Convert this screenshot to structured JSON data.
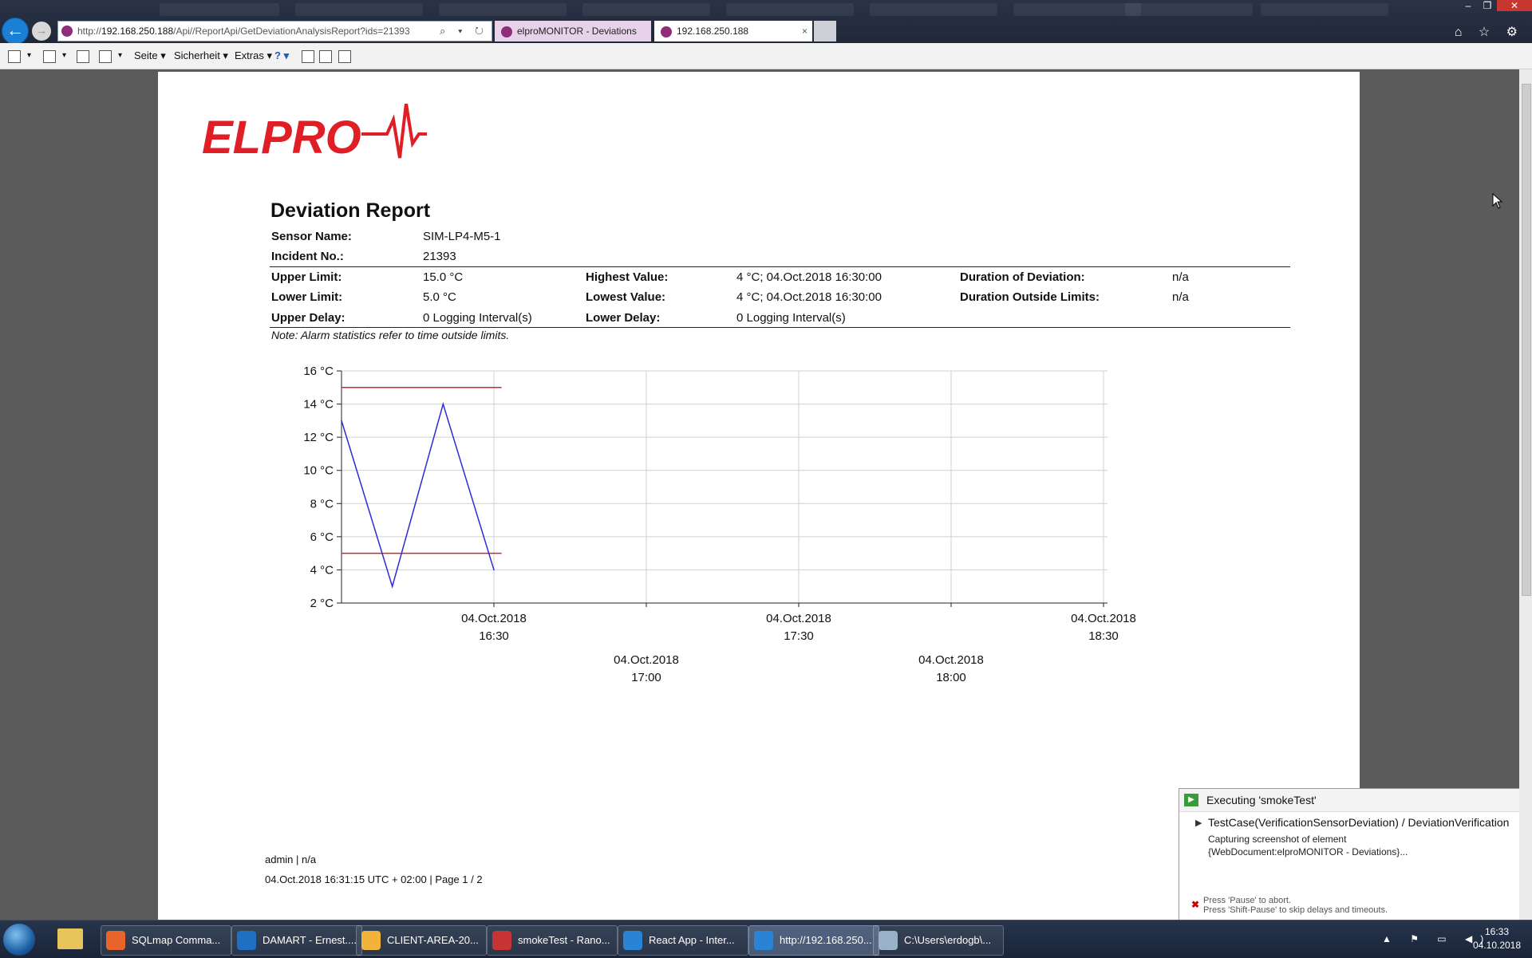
{
  "browser": {
    "url_prefix": "http://",
    "url_host": "192.168.250.188",
    "url_path": "/Api//ReportApi/GetDeviationAnalysisReport?ids=21393",
    "tabs": [
      {
        "label": "elproMONITOR - Deviations"
      },
      {
        "label": "192.168.250.188"
      }
    ],
    "close_glyph": "×",
    "addr_controls": "⌕ ▾ ↻",
    "nav_icons": "⌂ ☆ ⚙",
    "window_controls": {
      "minimize": "–",
      "maximize": "❐",
      "close": "✕"
    }
  },
  "commandbar": {
    "seite": "Seite",
    "sicherheit": "Sicherheit",
    "extras": "Extras",
    "help": "?"
  },
  "report": {
    "logo_text": "ELPRO",
    "title": "Deviation Report",
    "sensor_name_label": "Sensor Name:",
    "sensor_name": "SIM-LP4-M5-1",
    "incident_label": "Incident No.:",
    "incident": "21393",
    "upper_limit_label": "Upper Limit:",
    "upper_limit": "15.0 °C",
    "lower_limit_label": "Lower Limit:",
    "lower_limit": "5.0 °C",
    "upper_delay_label": "Upper Delay:",
    "upper_delay": "0 Logging Interval(s)",
    "highest_label": "Highest Value:",
    "highest": "4 °C; 04.Oct.2018 16:30:00",
    "lowest_label": "Lowest Value:",
    "lowest": "4 °C; 04.Oct.2018 16:30:00",
    "lower_delay_label": "Lower Delay:",
    "lower_delay": "0 Logging Interval(s)",
    "duration_dev_label": "Duration of Deviation:",
    "duration_dev": "n/a",
    "duration_out_label": "Duration Outside Limits:",
    "duration_out": "n/a",
    "note": "Note: Alarm statistics refer to time outside limits.",
    "footer_user": "admin | n/a",
    "footer_date": "04.Oct.2018 16:31:15 UTC + 02:00 | Page 1 / 2"
  },
  "chart_data": {
    "type": "line",
    "ylim": [
      2,
      16
    ],
    "y_ticks": [
      2,
      4,
      6,
      8,
      10,
      12,
      14,
      16
    ],
    "y_unit": "°C",
    "x_range_minutes": [
      0,
      120
    ],
    "x_ticks": [
      {
        "minute": 0,
        "date": "04.Oct.2018",
        "time": "16:30",
        "row": 0
      },
      {
        "minute": 30,
        "date": "04.Oct.2018",
        "time": "17:00",
        "row": 1
      },
      {
        "minute": 60,
        "date": "04.Oct.2018",
        "time": "17:30",
        "row": 0
      },
      {
        "minute": 90,
        "date": "04.Oct.2018",
        "time": "18:00",
        "row": 1
      },
      {
        "minute": 120,
        "date": "04.Oct.2018",
        "time": "18:30",
        "row": 0
      }
    ],
    "series": [
      {
        "color": "#2b2bd9",
        "points": [
          {
            "minute": -30,
            "value": 13
          },
          {
            "minute": -20,
            "value": 3
          },
          {
            "minute": -10,
            "value": 14
          },
          {
            "minute": 0,
            "value": 4
          }
        ]
      }
    ],
    "limits": [
      {
        "value": 15,
        "color": "#d92424",
        "from_minute": -30,
        "to_minute": 1.5
      },
      {
        "value": 5,
        "color": "#d92424",
        "from_minute": -30,
        "to_minute": 1.5
      }
    ],
    "grid": true
  },
  "ranorex": {
    "title": "Executing 'smokeTest'",
    "testcase": "TestCase(VerificationSensorDeviation)  /  DeviationVerification",
    "status1": "Capturing screenshot of element",
    "status2": "{WebDocument:elproMONITOR - Deviations}...",
    "hint1": "Press 'Pause' to abort.",
    "hint2": "Press 'Shift-Pause' to skip delays and timeouts."
  },
  "taskbar": {
    "buttons": [
      {
        "label": "SQLmap Comma...",
        "color": "#e8642a"
      },
      {
        "label": "DAMART - Ernest....",
        "color": "#1f6fc3"
      },
      {
        "label": "CLIENT-AREA-20...",
        "color": "#f2b33d"
      },
      {
        "label": "smokeTest - Rano...",
        "color": "#c73434"
      },
      {
        "label": "React App - Inter...",
        "color": "#2b83d6"
      },
      {
        "label": "http://192.168.250...",
        "color": "#2b83d6"
      },
      {
        "label": "C:\\Users\\erdogb\\...",
        "color": "#9ab2c9"
      }
    ],
    "time": "16:33",
    "date": "04.10.2018"
  }
}
